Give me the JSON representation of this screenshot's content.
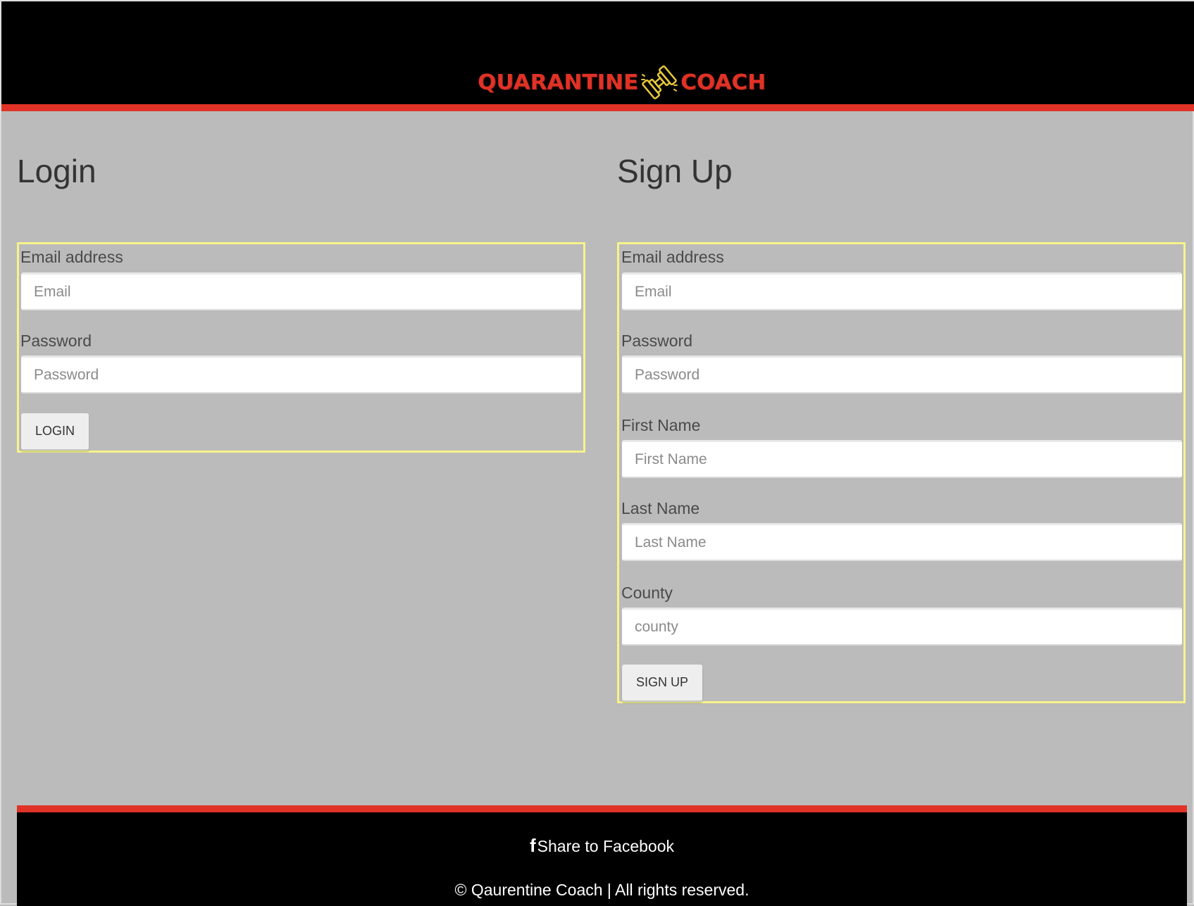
{
  "brand": {
    "logo_left": "QUARANTINE",
    "logo_right": "COACH",
    "logo_color": "#e03226",
    "logo_mark_color": "#e8c83a",
    "accent_stripe_color": "#e03226"
  },
  "login": {
    "title": "Login",
    "email_label": "Email address",
    "email_placeholder": "Email",
    "password_label": "Password",
    "password_placeholder": "Password",
    "submit_label": "LOGIN"
  },
  "signup": {
    "title": "Sign Up",
    "email_label": "Email address",
    "email_placeholder": "Email",
    "password_label": "Password",
    "password_placeholder": "Password",
    "first_name_label": "First Name",
    "first_name_placeholder": "First Name",
    "last_name_label": "Last Name",
    "last_name_placeholder": "Last Name",
    "county_label": "County",
    "county_placeholder": "county",
    "submit_label": "SIGN UP"
  },
  "footer": {
    "share_icon": "facebook-f-icon",
    "share_label": "Share to Facebook",
    "copyright": "© Qaurentine Coach | All rights reserved."
  }
}
